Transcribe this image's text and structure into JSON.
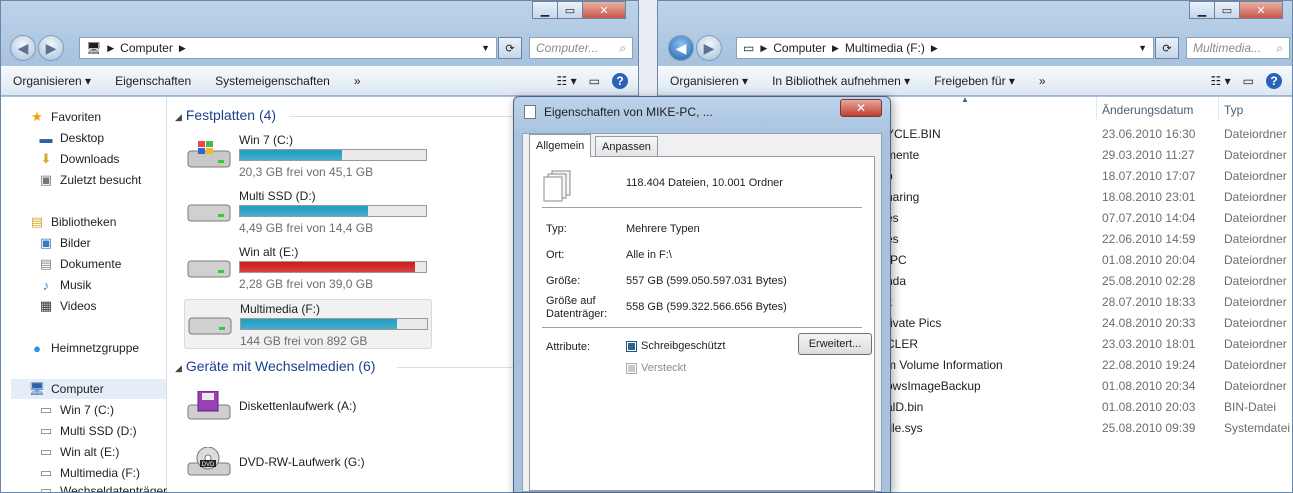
{
  "left_window": {
    "address": [
      "Computer"
    ],
    "search_placeholder": "Computer...",
    "toolbar": [
      "Organisieren",
      "Eigenschaften",
      "Systemeigenschaften",
      "»"
    ],
    "nav": {
      "favorites": "Favoriten",
      "fav_items": [
        "Desktop",
        "Downloads",
        "Zuletzt besucht"
      ],
      "libraries": "Bibliotheken",
      "lib_items": [
        "Bilder",
        "Dokumente",
        "Musik",
        "Videos"
      ],
      "homegroup": "Heimnetzgruppe",
      "computer": "Computer",
      "drives": [
        "Win 7 (C:)",
        "Multi SSD (D:)",
        "Win alt (E:)",
        "Multimedia (F:)",
        "Wechseldatenträger"
      ]
    },
    "hdd_group": "Festplatten (4)",
    "drives": [
      {
        "name": "Win 7 (C:)",
        "free": "20,3 GB frei von 45,1 GB",
        "used_fraction": 0.55,
        "color": "#1f9dc4"
      },
      {
        "name": "Multi SSD (D:)",
        "free": "4,49 GB frei von 14,4 GB",
        "used_fraction": 0.69,
        "color": "#1f9dc4"
      },
      {
        "name": "Win alt (E:)",
        "free": "2,28 GB frei von 39,0 GB",
        "used_fraction": 0.94,
        "color": "#d01a1a"
      },
      {
        "name": "Multimedia (F:)",
        "free": "144 GB frei von 892 GB",
        "used_fraction": 0.84,
        "color": "#1f9dc4"
      }
    ],
    "removable_group": "Geräte mit Wechselmedien (6)",
    "removables": [
      "Diskettenlaufwerk (A:)",
      "DVD-RW-Laufwerk (G:)"
    ],
    "removable_icons": [
      "floppy-icon",
      "dvd-icon"
    ]
  },
  "right_window": {
    "address": [
      "Computer",
      "Multimedia (F:)"
    ],
    "search_placeholder": "Multimedia...",
    "toolbar": [
      "Organisieren",
      "In Bibliothek aufnehmen",
      "Freigeben für",
      "»"
    ],
    "columns": {
      "date": "Änderungsdatum",
      "type": "Typ"
    },
    "rows": [
      {
        "name": "YCLE.BIN",
        "date": "23.06.2010 16:30",
        "type": "Dateiordner"
      },
      {
        "name": "mente",
        "date": "29.03.2010 11:27",
        "type": "Dateiordner"
      },
      {
        "name": "p",
        "date": "18.07.2010 17:07",
        "type": "Dateiordner"
      },
      {
        "name": "haring",
        "date": "18.08.2010 23:01",
        "type": "Dateiordner"
      },
      {
        "name": "es",
        "date": "07.07.2010 14:04",
        "type": "Dateiordner"
      },
      {
        "name": "es",
        "date": "22.06.2010 14:59",
        "type": "Dateiordner"
      },
      {
        "name": "-PC",
        "date": "01.08.2010 20:04",
        "type": "Dateiordner"
      },
      {
        "name": "nda",
        "date": "25.08.2010 02:28",
        "type": "Dateiordner"
      },
      {
        "name": "k",
        "date": "28.07.2010 18:33",
        "type": "Dateiordner"
      },
      {
        "name": "rivate Pics",
        "date": "24.08.2010 20:33",
        "type": "Dateiordner"
      },
      {
        "name": "CLER",
        "date": "23.03.2010 18:01",
        "type": "Dateiordner"
      },
      {
        "name": "m Volume Information",
        "date": "22.08.2010 19:24",
        "type": "Dateiordner"
      },
      {
        "name": "owsImageBackup",
        "date": "01.08.2010 20:34",
        "type": "Dateiordner"
      },
      {
        "name": "alD.bin",
        "date": "01.08.2010 20:03",
        "type": "BIN-Datei"
      },
      {
        "name": "file.sys",
        "date": "25.08.2010 09:39",
        "type": "Systemdatei"
      }
    ]
  },
  "dialog": {
    "title": "Eigenschaften von MIKE-PC, ...",
    "tabs": [
      "Allgemein",
      "Anpassen"
    ],
    "summary": "118.404 Dateien, 10.001 Ordner",
    "labels": {
      "type": "Typ:",
      "location": "Ort:",
      "size": "Größe:",
      "ondisk1": "Größe auf",
      "ondisk2": "Datenträger:",
      "attributes": "Attribute:"
    },
    "values": {
      "type": "Mehrere Typen",
      "location": "Alle in F:\\",
      "size": "557 GB (599.050.597.031 Bytes)",
      "ondisk": "558 GB (599.322.566.656 Bytes)"
    },
    "readonly": "Schreibgeschützt",
    "hidden": "Versteckt",
    "advanced": "Erweitert..."
  }
}
